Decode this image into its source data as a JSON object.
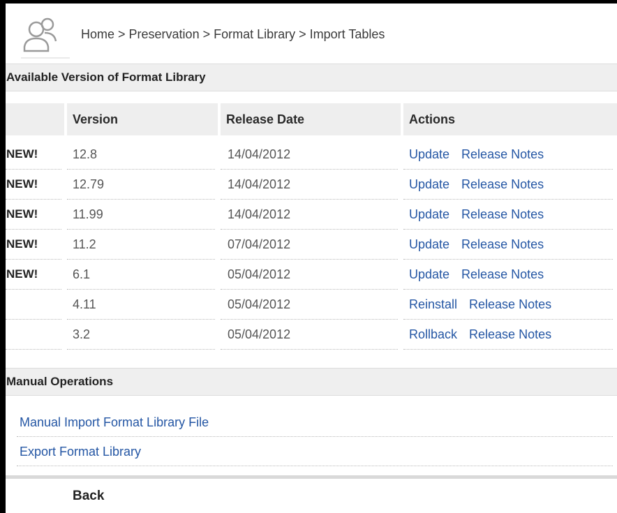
{
  "breadcrumb": {
    "items": [
      "Home",
      "Preservation",
      "Format Library",
      "Import Tables"
    ],
    "separator": " > "
  },
  "sections": {
    "available_title": "Available Version of Format Library",
    "manual_title": "Manual Operations"
  },
  "table": {
    "columns": [
      "",
      "Version",
      "Release Date",
      "Actions"
    ],
    "rows": [
      {
        "badge": "NEW!",
        "version": "12.8",
        "date": "14/04/2012",
        "action": "Update",
        "notes": "Release Notes"
      },
      {
        "badge": "NEW!",
        "version": "12.79",
        "date": "14/04/2012",
        "action": "Update",
        "notes": "Release Notes"
      },
      {
        "badge": "NEW!",
        "version": "11.99",
        "date": "14/04/2012",
        "action": "Update",
        "notes": "Release Notes"
      },
      {
        "badge": "NEW!",
        "version": "11.2",
        "date": "07/04/2012",
        "action": "Update",
        "notes": "Release Notes"
      },
      {
        "badge": "NEW!",
        "version": "6.1",
        "date": "05/04/2012",
        "action": "Update",
        "notes": "Release Notes"
      },
      {
        "badge": "",
        "version": "4.11",
        "date": "05/04/2012",
        "action": "Reinstall",
        "notes": "Release Notes"
      },
      {
        "badge": "",
        "version": "3.2",
        "date": "05/04/2012",
        "action": "Rollback",
        "notes": "Release Notes"
      }
    ]
  },
  "manual_operations": [
    "Manual Import Format Library File",
    "Export Format Library"
  ],
  "footer": {
    "back_label": "Back"
  },
  "icons": {
    "header": "users-group-icon"
  },
  "colors": {
    "link": "#2456a4",
    "section_bg": "#efefef",
    "header_cell_bg": "#eeeeee"
  }
}
